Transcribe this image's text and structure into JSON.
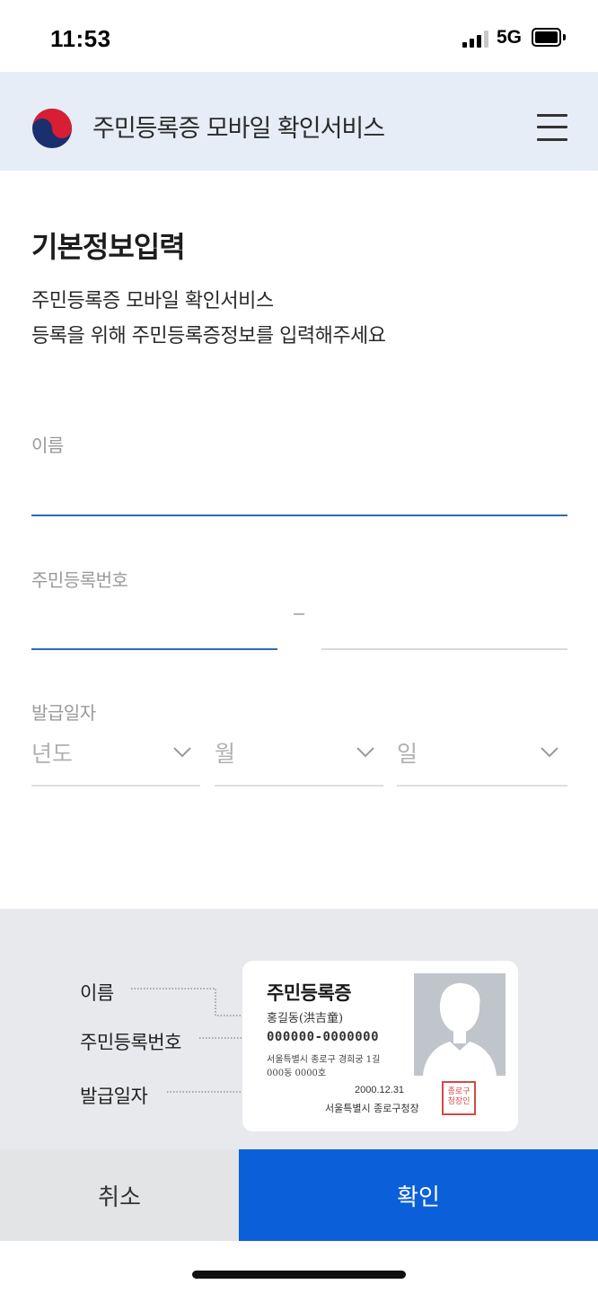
{
  "status_bar": {
    "time": "11:53",
    "network": "5G"
  },
  "header": {
    "title": "주민등록증 모바일 확인서비스",
    "logo_icon": "korea-government-emblem-icon",
    "menu_icon": "hamburger-menu-icon"
  },
  "page": {
    "title": "기본정보입력",
    "desc_line1": "주민등록증 모바일 확인서비스",
    "desc_line2": "등록을 위해 주민등록증정보를 입력해주세요"
  },
  "form": {
    "name_label": "이름",
    "name_value": "",
    "rrn_label": "주민등록번호",
    "rrn_front_value": "",
    "rrn_back_value": "",
    "issue_date_label": "발급일자",
    "year_placeholder": "년도",
    "month_placeholder": "월",
    "day_placeholder": "일"
  },
  "info_panel": {
    "labels": {
      "name": "이름",
      "rrn": "주민등록번호",
      "issue_date": "발급일자"
    },
    "card": {
      "title": "주민등록증",
      "name": "홍길동(洪吉童)",
      "rrn": "000000-0000000",
      "address_line1": "서울특별시 종로구 경희궁 1길",
      "address_line2": "000동 0000호",
      "date": "2000.12.31",
      "issuer": "서울특별시 종로구청장",
      "stamp_line1": "종로구",
      "stamp_line2": "청장인"
    }
  },
  "buttons": {
    "cancel": "취소",
    "confirm": "확인"
  },
  "colors": {
    "header_bg": "#e6edf6",
    "primary": "#0b5fd9",
    "active_line": "#2f6bb0",
    "panel_bg": "#e8e9ec"
  }
}
